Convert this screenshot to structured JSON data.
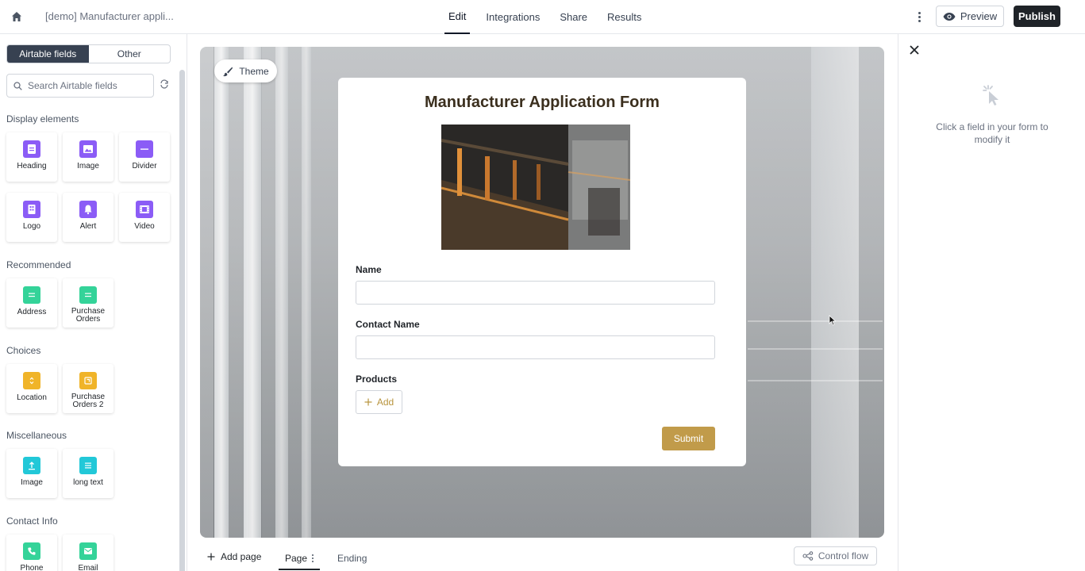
{
  "header": {
    "doc_title": "[demo] Manufacturer appli...",
    "tabs": [
      {
        "label": "Edit",
        "active": true
      },
      {
        "label": "Integrations",
        "active": false
      },
      {
        "label": "Share",
        "active": false
      },
      {
        "label": "Results",
        "active": false
      }
    ],
    "preview_label": "Preview",
    "publish_label": "Publish"
  },
  "sidebar": {
    "segments": [
      "Airtable fields",
      "Other"
    ],
    "search_placeholder": "Search Airtable fields",
    "sections": [
      {
        "title": "Display elements",
        "items": [
          {
            "label": "Heading",
            "icon": "heading-icon",
            "color": "#8b5cf6"
          },
          {
            "label": "Image",
            "icon": "image-icon",
            "color": "#8b5cf6"
          },
          {
            "label": "Divider",
            "icon": "divider-icon",
            "color": "#8b5cf6"
          },
          {
            "label": "Logo",
            "icon": "logo-icon",
            "color": "#8b5cf6"
          },
          {
            "label": "Alert",
            "icon": "bell-icon",
            "color": "#8b5cf6"
          },
          {
            "label": "Video",
            "icon": "video-icon",
            "color": "#8b5cf6"
          }
        ]
      },
      {
        "title": "Recommended",
        "items": [
          {
            "label": "Address",
            "icon": "text-lines-icon",
            "color": "#34d399"
          },
          {
            "label": "Purchase Orders",
            "icon": "text-lines-icon",
            "color": "#34d399"
          }
        ]
      },
      {
        "title": "Choices",
        "items": [
          {
            "label": "Location",
            "icon": "select-icon",
            "color": "#f0b429"
          },
          {
            "label": "Purchase Orders 2",
            "icon": "linked-record-icon",
            "color": "#f0b429"
          }
        ]
      },
      {
        "title": "Miscellaneous",
        "items": [
          {
            "label": "Image",
            "icon": "upload-icon",
            "color": "#22c8d8"
          },
          {
            "label": "long text",
            "icon": "text-lines-icon",
            "color": "#22c8d8"
          }
        ]
      },
      {
        "title": "Contact Info",
        "items": [
          {
            "label": "Phone",
            "icon": "phone-icon",
            "color": "#34d399"
          },
          {
            "label": "Email",
            "icon": "mail-icon",
            "color": "#34d399"
          }
        ]
      }
    ]
  },
  "canvas": {
    "theme_label": "Theme",
    "form": {
      "title": "Manufacturer Application Form",
      "fields": [
        {
          "label": "Name",
          "value": ""
        },
        {
          "label": "Contact Name",
          "value": ""
        },
        {
          "label": "Products",
          "add_label": "Add"
        }
      ],
      "submit_label": "Submit"
    }
  },
  "footer": {
    "add_page_label": "Add page",
    "page_label": "Page",
    "ending_label": "Ending",
    "control_flow_label": "Control flow"
  },
  "right_panel": {
    "hint": "Click a field in your form to modify it"
  }
}
